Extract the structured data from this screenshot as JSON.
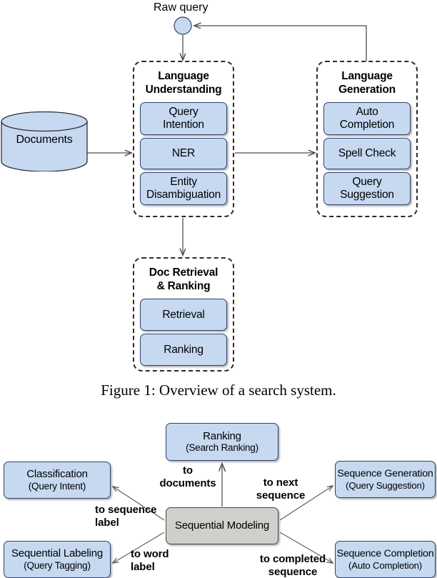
{
  "figure1": {
    "raw_query_label": "Raw query",
    "datastore": {
      "label": "Documents"
    },
    "groups": [
      {
        "id": "language-understanding",
        "title": "Language\nUnderstanding",
        "ellipsis": "……",
        "items": [
          {
            "label": "Query\nIntention"
          },
          {
            "label": "NER"
          },
          {
            "label": "Entity\nDisambiguation"
          }
        ]
      },
      {
        "id": "language-generation",
        "title": "Language\nGeneration",
        "ellipsis": "……",
        "items": [
          {
            "label": "Auto\nCompletion"
          },
          {
            "label": "Spell Check"
          },
          {
            "label": "Query\nSuggestion"
          }
        ]
      },
      {
        "id": "doc-retrieval-ranking",
        "title": "Doc Retrieval\n& Ranking",
        "ellipsis": "",
        "items": [
          {
            "label": "Retrieval"
          },
          {
            "label": "Ranking"
          }
        ]
      }
    ],
    "caption": "Figure 1: Overview of a search system."
  },
  "figure2": {
    "center": {
      "label": "Sequential Modeling"
    },
    "nodes": [
      {
        "id": "ranking",
        "title": "Ranking",
        "subtitle": "(Search Ranking)"
      },
      {
        "id": "classification",
        "title": "Classification",
        "subtitle": "(Query Intent)"
      },
      {
        "id": "sequential-labeling",
        "title": "Sequential Labeling",
        "subtitle": "(Query Tagging)"
      },
      {
        "id": "sequence-generation",
        "title": "Sequence Generation",
        "subtitle": "(Query Suggestion)"
      },
      {
        "id": "sequence-completion",
        "title": "Sequence Completion",
        "subtitle": "(Auto Completion)"
      }
    ],
    "edge_labels": [
      {
        "id": "to-documents",
        "text": "to\ndocuments"
      },
      {
        "id": "to-sequence-label",
        "text": "to sequence\nlabel"
      },
      {
        "id": "to-word-label",
        "text": "to word\nlabel"
      },
      {
        "id": "to-next-sequence",
        "text": "to next\nsequence"
      },
      {
        "id": "to-completed-sequence",
        "text": "to completed\nsequence"
      }
    ]
  },
  "colors": {
    "node_fill": "#c6d9f1",
    "node_stroke": "#31436b",
    "center_fill": "#cfcfcb",
    "group_stroke": "#2b2b2b",
    "arrow_stroke": "#4d4d4d",
    "background": "#ffffff"
  }
}
